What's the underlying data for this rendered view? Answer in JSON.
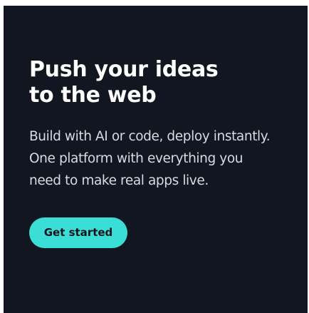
{
  "hero": {
    "headline_lines": [
      "Push your ideas",
      "to the web"
    ],
    "subtext_lines": [
      "Build with AI or code, deploy instantly.",
      "One platform with everything you",
      "need to make real apps live."
    ],
    "cta_label": "Get started"
  },
  "colors": {
    "background": "#121620",
    "headline": "#ffffff",
    "subtext": "#d8dbe2",
    "accent": "#3bded6",
    "cta_text": "#10141c"
  }
}
